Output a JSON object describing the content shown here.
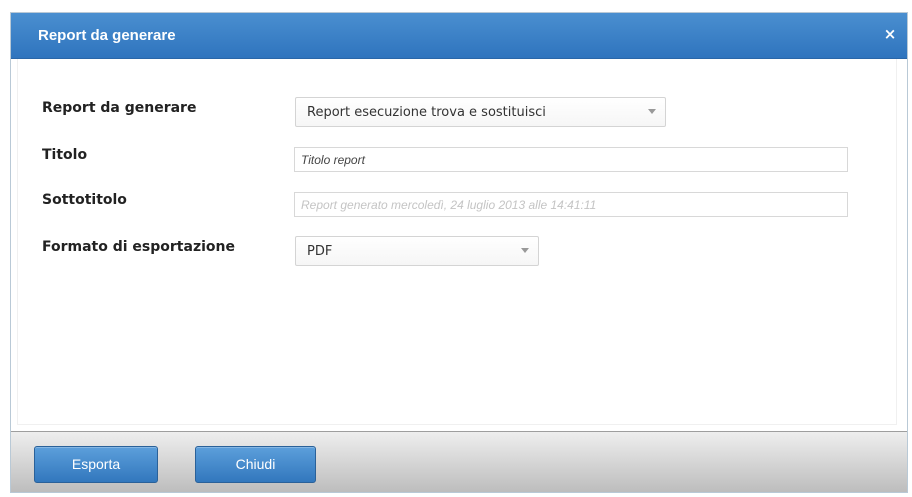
{
  "dialog": {
    "title": "Report da generare",
    "close_glyph": "×"
  },
  "form": {
    "report": {
      "label": "Report da generare",
      "selected": "Report esecuzione trova e sostituisci"
    },
    "titolo": {
      "label": "Titolo",
      "value": "Titolo report"
    },
    "sottotitolo": {
      "label": "Sottotitolo",
      "placeholder": "Report generato mercoledì, 24 luglio 2013 alle 14:41:11"
    },
    "formato": {
      "label": "Formato di esportazione",
      "selected": "PDF"
    }
  },
  "footer": {
    "export_label": "Esporta",
    "close_label": "Chiudi"
  },
  "icons": {
    "close": "close-icon",
    "dropdown": "chevron-down-icon"
  },
  "colors": {
    "header": "#3a80c6",
    "button": "#4489cd",
    "footer": "#cfcfcf"
  }
}
